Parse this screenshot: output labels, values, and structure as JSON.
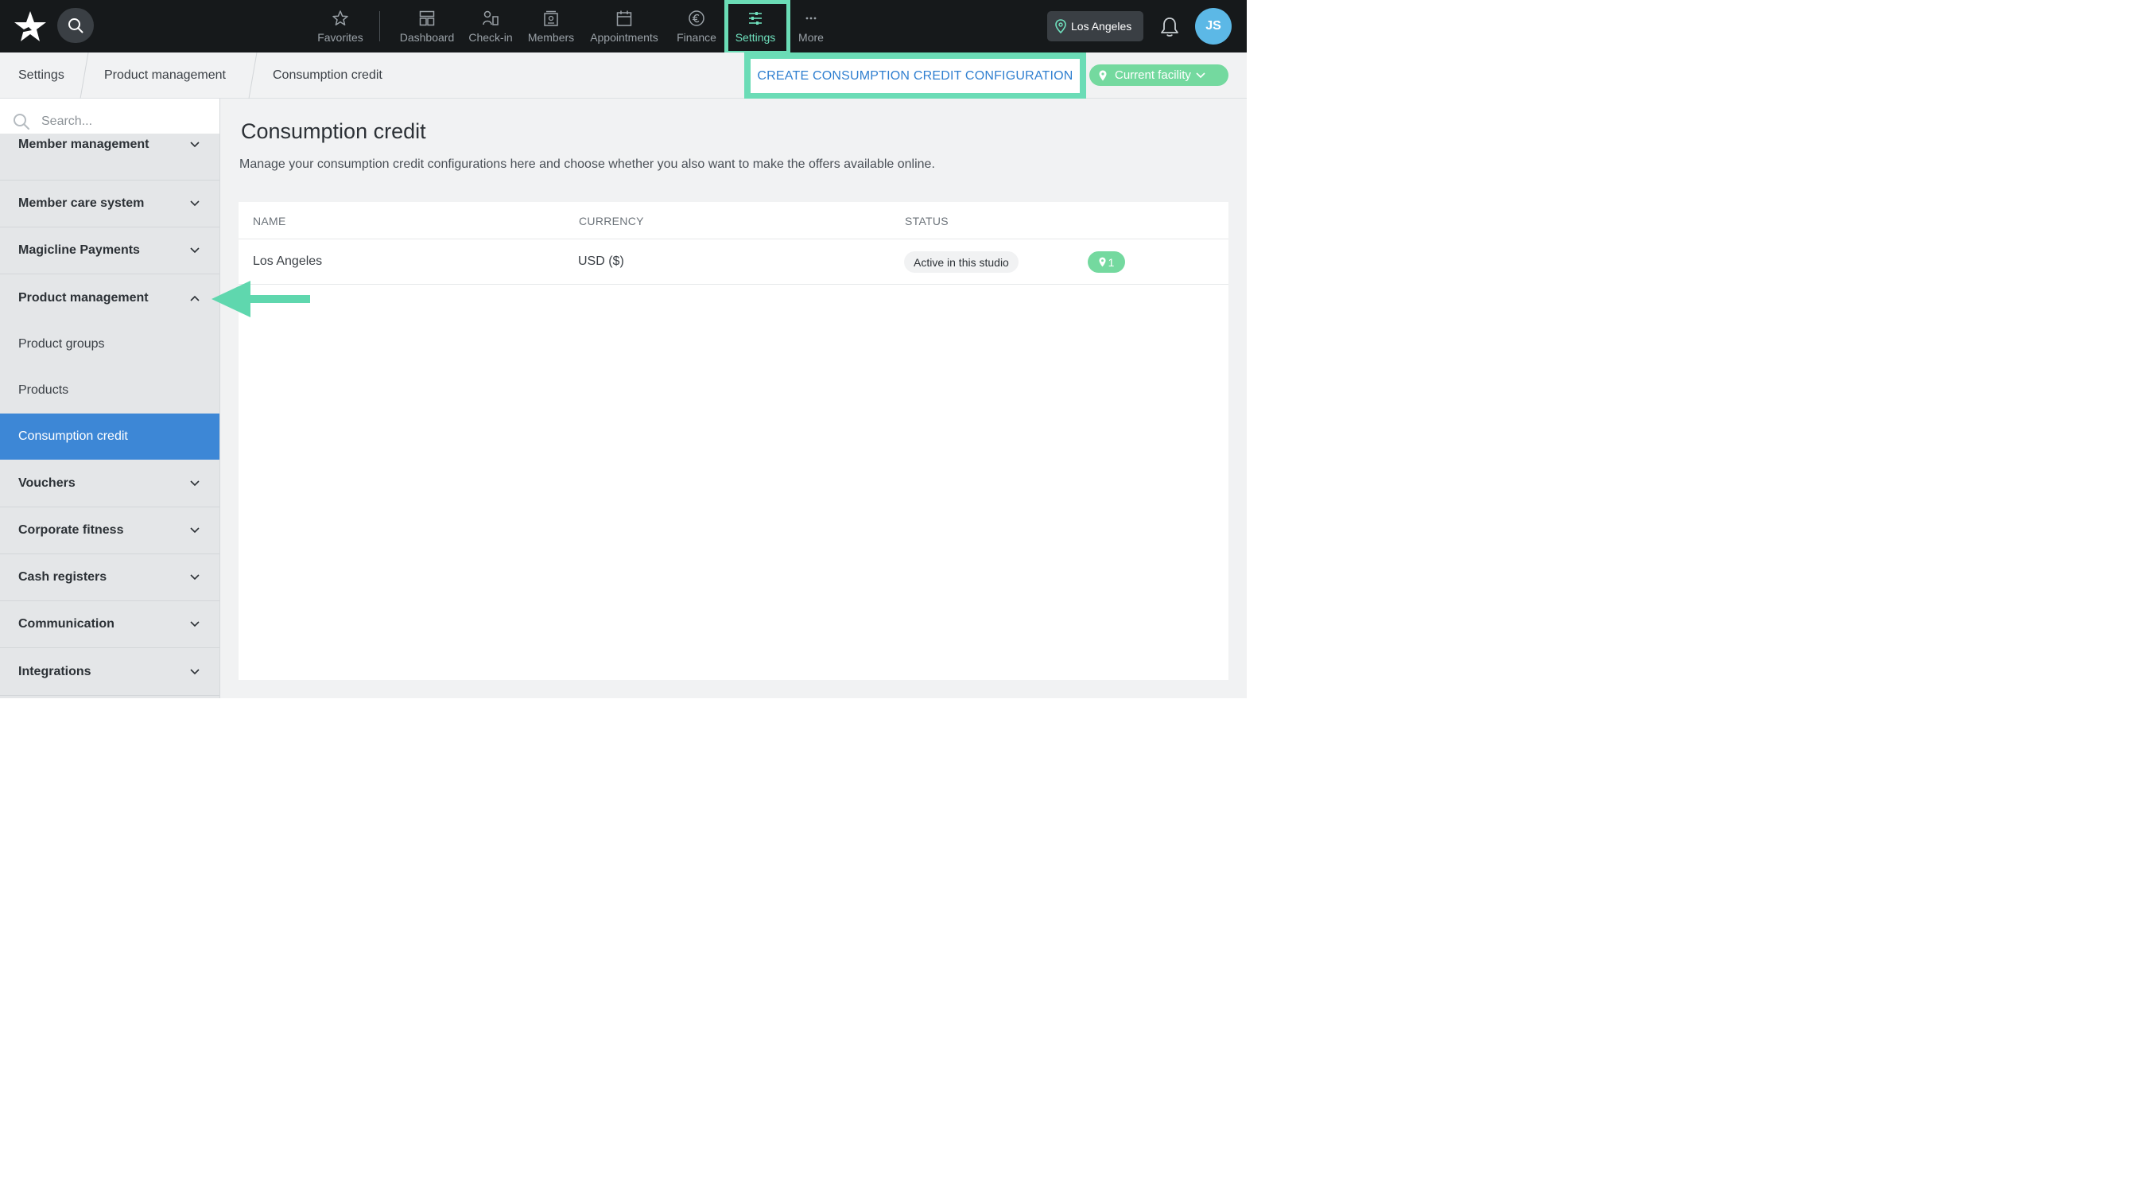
{
  "colors": {
    "topnav_bg": "#16191b",
    "accent_green": "#6bdcb6",
    "primary_blue": "#3d87d6",
    "link_blue": "#2f7fd0",
    "facility_green": "#74d99f",
    "avatar_blue": "#5cb8e6"
  },
  "topnav": {
    "logo_icon": "star-logo-icon",
    "search_icon": "search-icon",
    "items": [
      {
        "label": "Favorites",
        "icon": "star-icon"
      },
      {
        "label": "Dashboard",
        "icon": "dashboard-icon"
      },
      {
        "label": "Check-in",
        "icon": "check-in-icon"
      },
      {
        "label": "Members",
        "icon": "members-icon"
      },
      {
        "label": "Appointments",
        "icon": "calendar-icon"
      },
      {
        "label": "Finance",
        "icon": "euro-icon"
      },
      {
        "label": "Settings",
        "icon": "sliders-icon"
      },
      {
        "label": "More",
        "icon": "ellipsis-icon"
      }
    ],
    "location": "Los Angeles",
    "avatar_initials": "JS"
  },
  "breadcrumb": [
    "Settings",
    "Product management",
    "Consumption credit"
  ],
  "actions": {
    "create_label": "CREATE CONSUMPTION CREDIT CONFIGURATION",
    "facility_label": "Current facility"
  },
  "sidebar": {
    "search_placeholder": "Search...",
    "items": [
      {
        "label": "Member management"
      },
      {
        "label": "Member care system"
      },
      {
        "label": "Magicline Payments"
      },
      {
        "label": "Product management"
      },
      {
        "label": "Vouchers"
      },
      {
        "label": "Corporate fitness"
      },
      {
        "label": "Cash registers"
      },
      {
        "label": "Communication"
      },
      {
        "label": "Integrations"
      }
    ],
    "sub_items": [
      {
        "label": "Product groups"
      },
      {
        "label": "Products"
      },
      {
        "label": "Consumption credit"
      }
    ]
  },
  "main": {
    "title": "Consumption credit",
    "description": "Manage your consumption credit configurations here and choose whether you also want to make the offers available online.",
    "table": {
      "headers": [
        "NAME",
        "CURRENCY",
        "STATUS"
      ],
      "rows": [
        {
          "name": "Los Angeles",
          "currency": "USD ($)",
          "status": "Active in this studio",
          "locations": "1"
        }
      ]
    }
  }
}
